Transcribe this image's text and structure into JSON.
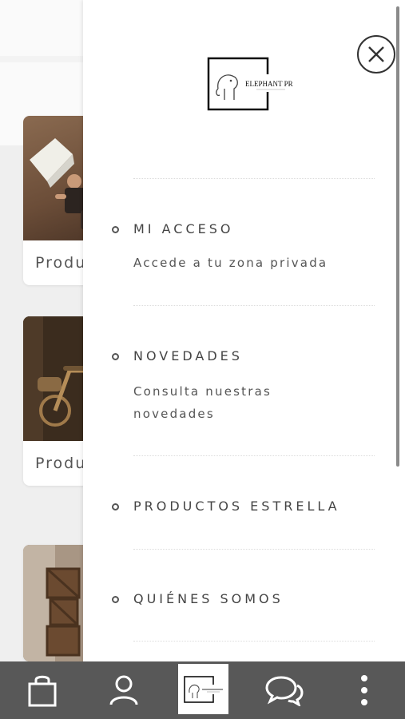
{
  "background": {
    "cards": [
      {
        "label": "Produ"
      },
      {
        "label": "Produ"
      }
    ]
  },
  "drawer": {
    "logo_text": "ELEPHANT PROPS",
    "menu": [
      {
        "title": "MI ACCESO",
        "subtitle": "Accede a tu zona privada"
      },
      {
        "title": "NOVEDADES",
        "subtitle": "Consulta nuestras novedades"
      },
      {
        "title": "PRODUCTOS ESTRELLA",
        "subtitle": ""
      },
      {
        "title": "QUIÉNES SOMOS",
        "subtitle": ""
      }
    ]
  },
  "bottom_nav": {
    "items": [
      {
        "icon": "shopping-bag-icon"
      },
      {
        "icon": "user-icon"
      },
      {
        "icon": "logo"
      },
      {
        "icon": "chat-icon"
      },
      {
        "icon": "more-vertical-icon"
      }
    ]
  },
  "colors": {
    "nav_bg": "#585858",
    "text": "#444444"
  }
}
